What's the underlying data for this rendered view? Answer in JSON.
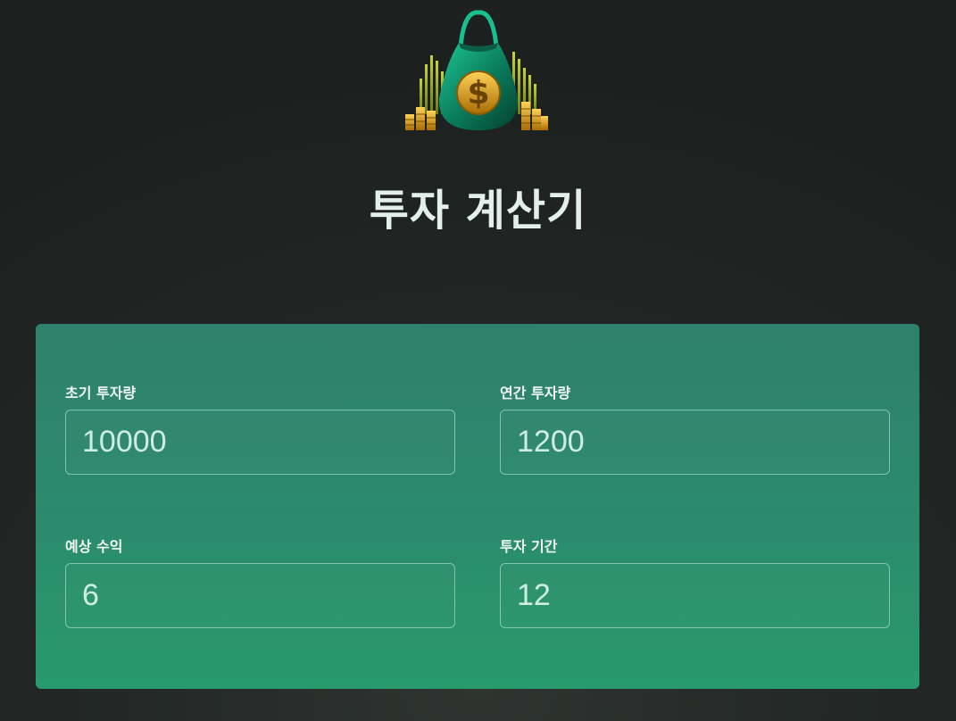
{
  "header": {
    "logo_icon": "money-bag-dollar-icon",
    "title": "투자 계산기"
  },
  "form": {
    "initial_investment": {
      "label": "초기 투자량",
      "value": "10000"
    },
    "annual_investment": {
      "label": "연간 투자량",
      "value": "1200"
    },
    "expected_return": {
      "label": "예상 수익",
      "value": "6"
    },
    "duration": {
      "label": "투자 기간",
      "value": "12"
    }
  },
  "colors": {
    "background": "#232826",
    "card": "#2b8b6d",
    "title": "#e3efea",
    "accent_gold": "#e0a41a",
    "bag_green": "#0f8f6a"
  }
}
